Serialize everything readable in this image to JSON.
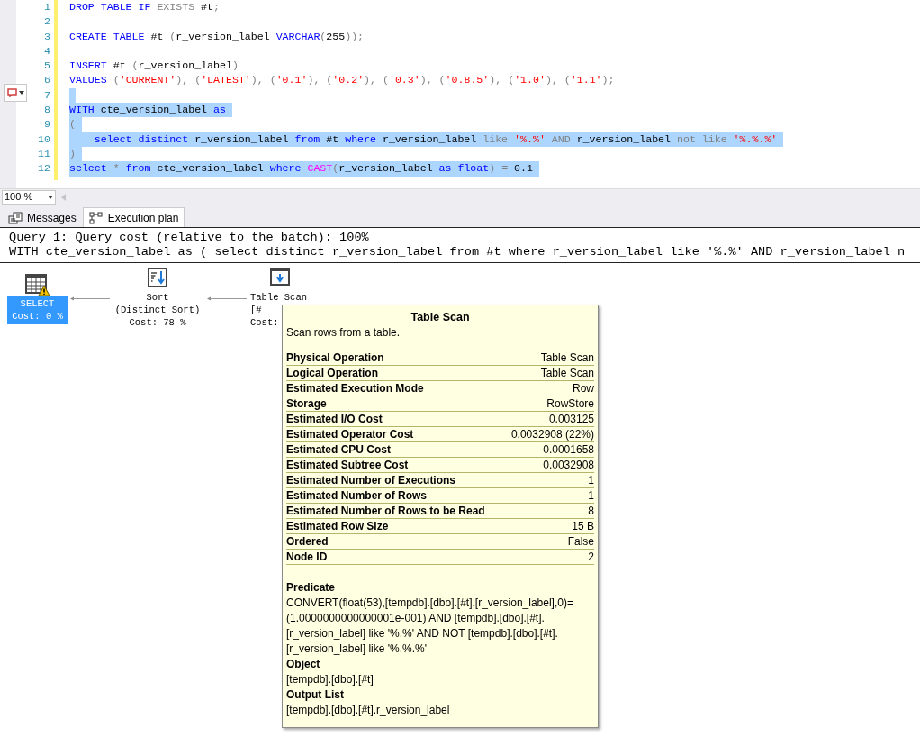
{
  "editor": {
    "lines": [
      {
        "number": "1",
        "selected": false,
        "tokens": [
          {
            "kind": "keyword",
            "text": "DROP TABLE IF"
          },
          {
            "kind": "gray",
            "text": " EXISTS"
          },
          {
            "kind": "plain",
            "text": " #t"
          },
          {
            "kind": "gray",
            "text": ";"
          }
        ]
      },
      {
        "number": "2",
        "selected": false
      },
      {
        "number": "3",
        "selected": false,
        "tokens": [
          {
            "kind": "keyword",
            "text": "CREATE TABLE"
          },
          {
            "kind": "plain",
            "text": " #t "
          },
          {
            "kind": "gray",
            "text": "("
          },
          {
            "kind": "plain",
            "text": "r_version_label "
          },
          {
            "kind": "keyword",
            "text": "VARCHAR"
          },
          {
            "kind": "gray",
            "text": "("
          },
          {
            "kind": "plain",
            "text": "255"
          },
          {
            "kind": "gray",
            "text": "));"
          }
        ]
      },
      {
        "number": "4",
        "selected": false
      },
      {
        "number": "5",
        "selected": false,
        "tokens": [
          {
            "kind": "keyword",
            "text": "INSERT"
          },
          {
            "kind": "plain",
            "text": " #t "
          },
          {
            "kind": "gray",
            "text": "("
          },
          {
            "kind": "plain",
            "text": "r_version_label"
          },
          {
            "kind": "gray",
            "text": ")"
          }
        ]
      },
      {
        "number": "6",
        "selected": false,
        "tokens": [
          {
            "kind": "keyword",
            "text": "VALUES"
          },
          {
            "kind": "gray",
            "text": " ("
          },
          {
            "kind": "string",
            "text": "'CURRENT'"
          },
          {
            "kind": "gray",
            "text": "), ("
          },
          {
            "kind": "string",
            "text": "'LATEST'"
          },
          {
            "kind": "gray",
            "text": "), ("
          },
          {
            "kind": "string",
            "text": "'0.1'"
          },
          {
            "kind": "gray",
            "text": "), ("
          },
          {
            "kind": "string",
            "text": "'0.2'"
          },
          {
            "kind": "gray",
            "text": "), ("
          },
          {
            "kind": "string",
            "text": "'0.3'"
          },
          {
            "kind": "gray",
            "text": "), ("
          },
          {
            "kind": "string",
            "text": "'0.8.5'"
          },
          {
            "kind": "gray",
            "text": "), ("
          },
          {
            "kind": "string",
            "text": "'1.0'"
          },
          {
            "kind": "gray",
            "text": "), ("
          },
          {
            "kind": "string",
            "text": "'1.1'"
          },
          {
            "kind": "gray",
            "text": ");"
          }
        ]
      },
      {
        "number": "7",
        "selected": true
      },
      {
        "number": "8",
        "selected": true,
        "tokens": [
          {
            "kind": "keyword",
            "text": "WITH"
          },
          {
            "kind": "plain",
            "text": " cte_version_label "
          },
          {
            "kind": "keyword",
            "text": "as"
          }
        ]
      },
      {
        "number": "9",
        "selected": true,
        "tokens": [
          {
            "kind": "gray",
            "text": "("
          }
        ]
      },
      {
        "number": "10",
        "selected": true,
        "tokens": [
          {
            "kind": "keyword",
            "text": "    select distinct"
          },
          {
            "kind": "plain",
            "text": " r_version_label "
          },
          {
            "kind": "keyword",
            "text": "from"
          },
          {
            "kind": "plain",
            "text": " #t "
          },
          {
            "kind": "keyword",
            "text": "where"
          },
          {
            "kind": "plain",
            "text": " r_version_label "
          },
          {
            "kind": "gray",
            "text": "like "
          },
          {
            "kind": "string",
            "text": "'%.%'"
          },
          {
            "kind": "gray",
            "text": " AND "
          },
          {
            "kind": "plain",
            "text": "r_version_label "
          },
          {
            "kind": "gray",
            "text": "not like "
          },
          {
            "kind": "string",
            "text": "'%.%.%'"
          }
        ]
      },
      {
        "number": "11",
        "selected": true,
        "tokens": [
          {
            "kind": "gray",
            "text": ")"
          }
        ]
      },
      {
        "number": "12",
        "selected": true,
        "tokens": [
          {
            "kind": "keyword",
            "text": "select"
          },
          {
            "kind": "gray",
            "text": " * "
          },
          {
            "kind": "keyword",
            "text": "from"
          },
          {
            "kind": "plain",
            "text": " cte_version_label "
          },
          {
            "kind": "keyword",
            "text": "where "
          },
          {
            "kind": "function",
            "text": "CAST"
          },
          {
            "kind": "gray",
            "text": "("
          },
          {
            "kind": "plain",
            "text": "r_version_label "
          },
          {
            "kind": "keyword",
            "text": "as float"
          },
          {
            "kind": "gray",
            "text": ") = "
          },
          {
            "kind": "plain",
            "text": "0.1"
          }
        ]
      }
    ]
  },
  "zoom": {
    "value": "100 %"
  },
  "tabs": [
    {
      "label": "Messages",
      "kind": "messages",
      "selected": false
    },
    {
      "label": "Execution plan",
      "kind": "plan",
      "selected": true
    }
  ],
  "plan": {
    "header": [
      "Query 1: Query cost (relative to the batch): 100%",
      "WITH cte_version_label as ( select distinct r_version_label from #t where r_version_label like '%.%' AND r_version_label n"
    ],
    "nodes": [
      {
        "kind": "select",
        "selected": true,
        "warning": true,
        "lines": [
          "SELECT",
          "Cost: 0 %"
        ]
      },
      {
        "kind": "sort",
        "selected": false,
        "warning": false,
        "lines": [
          "Sort",
          "(Distinct Sort)",
          "Cost: 78 %"
        ]
      },
      {
        "kind": "table_scan",
        "selected": false,
        "warning": false,
        "lines": [
          "Table Scan",
          "[#",
          "Cost:"
        ]
      }
    ]
  },
  "tooltip": {
    "title": "Table Scan",
    "description": "Scan rows from a table.",
    "properties": [
      {
        "label": "Physical Operation",
        "value": "Table Scan"
      },
      {
        "label": "Logical Operation",
        "value": "Table Scan"
      },
      {
        "label": "Estimated Execution Mode",
        "value": "Row"
      },
      {
        "label": "Storage",
        "value": "RowStore"
      },
      {
        "label": "Estimated I/O Cost",
        "value": "0.003125"
      },
      {
        "label": "Estimated Operator Cost",
        "value": "0.0032908 (22%)"
      },
      {
        "label": "Estimated CPU Cost",
        "value": "0.0001658"
      },
      {
        "label": "Estimated Subtree Cost",
        "value": "0.0032908"
      },
      {
        "label": "Estimated Number of Executions",
        "value": "1"
      },
      {
        "label": "Estimated Number of Rows",
        "value": "1"
      },
      {
        "label": "Estimated Number of Rows to be Read",
        "value": "8"
      },
      {
        "label": "Estimated Row Size",
        "value": "15 B"
      },
      {
        "label": "Ordered",
        "value": "False"
      },
      {
        "label": "Node ID",
        "value": "2"
      }
    ],
    "sections": [
      {
        "label": "Predicate",
        "text": "CONVERT(float(53),[tempdb].[dbo].[#t].[r_version_label],0)=(1.0000000000000001e-001) AND [tempdb].[dbo].[#t].[r_version_label] like '%.%' AND NOT [tempdb].[dbo].[#t].[r_version_label] like '%.%.%'"
      },
      {
        "label": "Object",
        "text": "[tempdb].[dbo].[#t]"
      },
      {
        "label": "Output List",
        "text": "[tempdb].[dbo].[#t].r_version_label"
      }
    ]
  }
}
